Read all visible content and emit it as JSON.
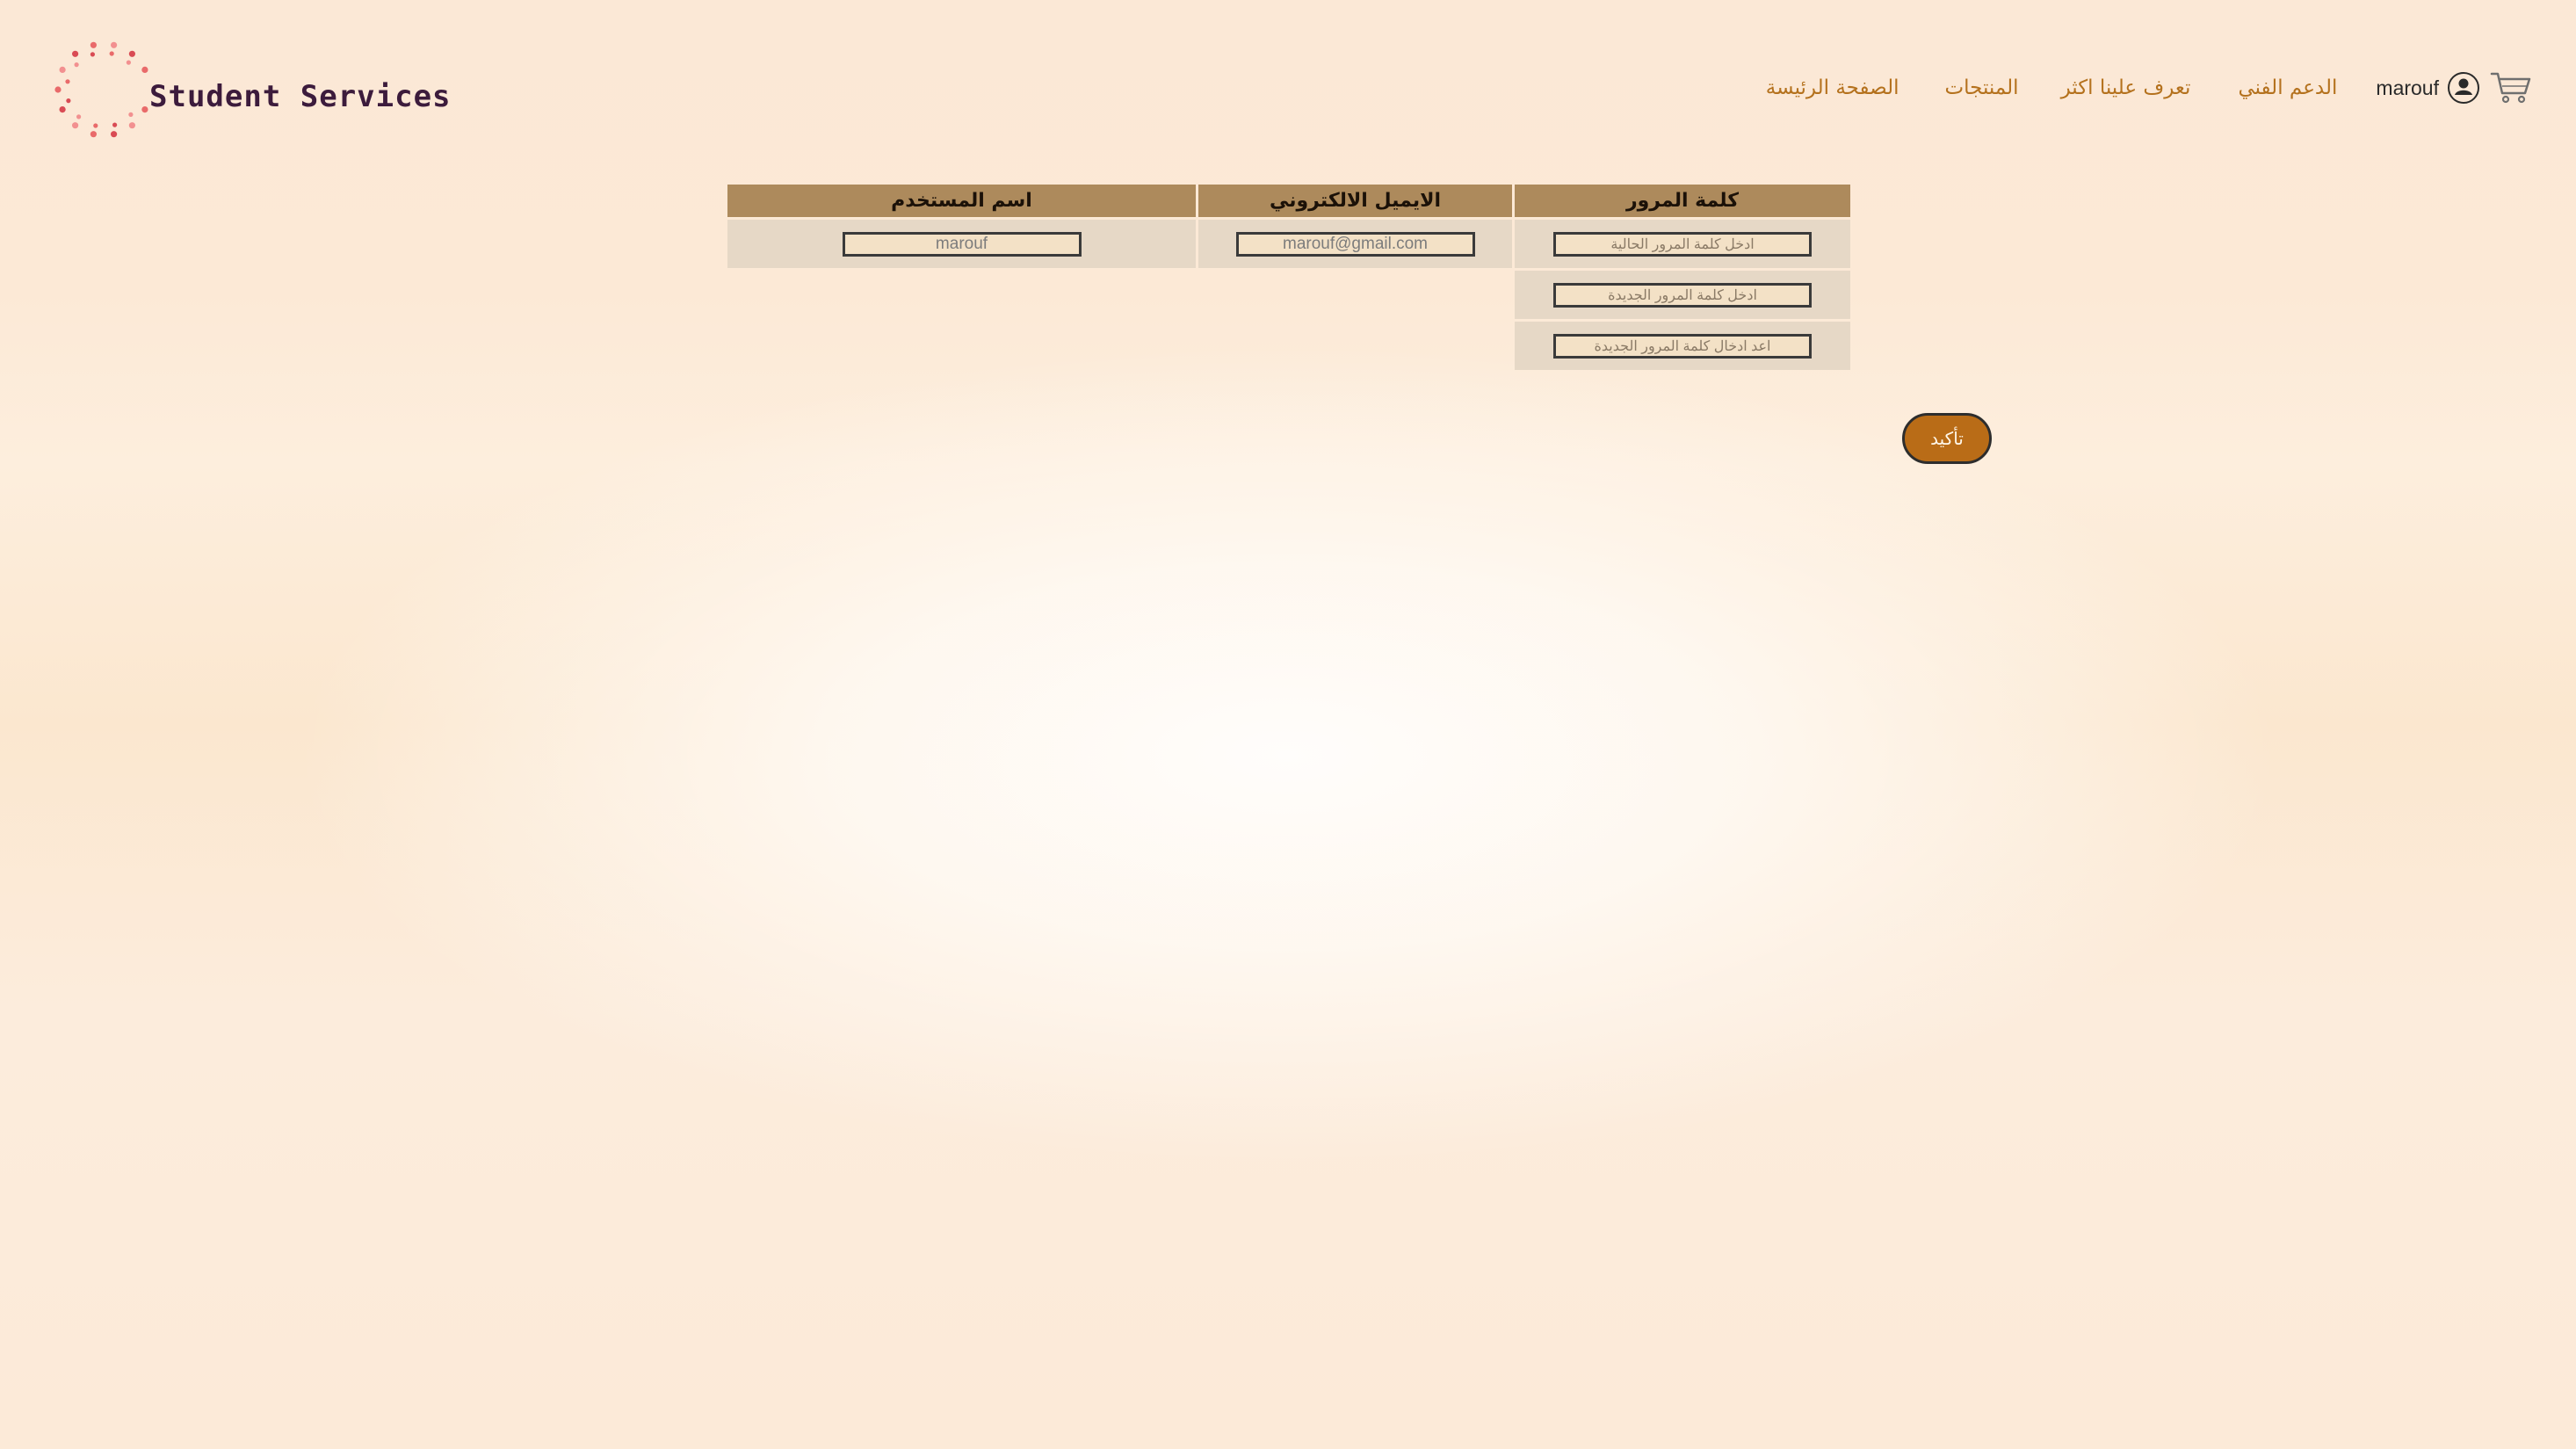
{
  "brand": {
    "name": "Student Services",
    "logo_dot_colors": [
      "#e96a6a",
      "#f29090",
      "#d94b54"
    ]
  },
  "nav": {
    "home": "الصفحة الرئيسة",
    "products": "المنتجات",
    "about": "تعرف علينا اكثر",
    "support": "الدعم الفني",
    "user_name": "marouf",
    "link_color": "#b4711d"
  },
  "form": {
    "headers": {
      "username": "اسم المستخدم",
      "email": "الايميل الالكتروني",
      "password": "كلمة المرور"
    },
    "username_value": "marouf",
    "email_value": "marouf@gmail.com",
    "current_password_placeholder": "ادخل كلمة المرور الحالية",
    "new_password_placeholder": "ادخل كلمة المرور الجديدة",
    "confirm_password_placeholder": "اعد ادخال كلمة المرور الجديدة",
    "header_color": "#ad8a5c",
    "cell_color": "#e6d8c6"
  },
  "confirm_button": {
    "label": "تأكيد",
    "color": "#b96c17"
  }
}
